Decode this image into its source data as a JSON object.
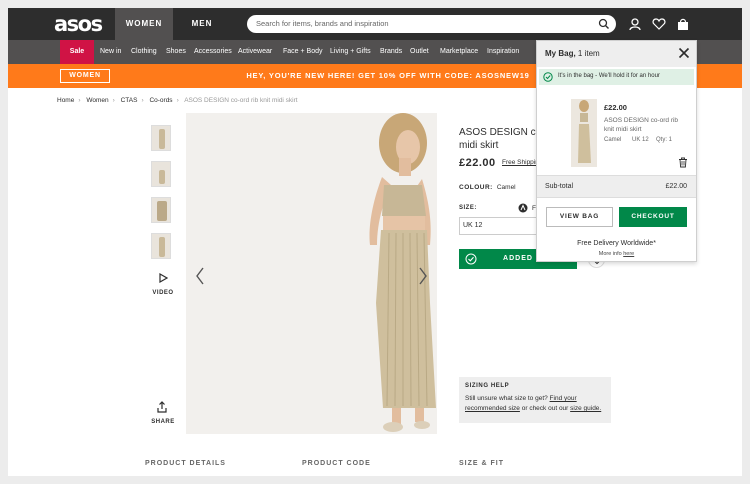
{
  "header": {
    "logo": "asos",
    "tabs": [
      {
        "label": "WOMEN"
      },
      {
        "label": "MEN"
      }
    ],
    "search_placeholder": "Search for items, brands and inspiration",
    "icons": [
      "account-icon",
      "heart-icon",
      "bag-icon"
    ]
  },
  "nav": {
    "sale": "Sale",
    "items": [
      "New in",
      "Clothing",
      "Shoes",
      "Accessories",
      "Activewear",
      "Face + Body",
      "Living + Gifts",
      "Brands",
      "Outlet",
      "Marketplace",
      "Inspiration"
    ]
  },
  "promo": {
    "button": "WOMEN",
    "text": "HEY, YOU'RE NEW HERE! GET 10% OFF WITH CODE: ASOSNEW19"
  },
  "breadcrumb": [
    "Home",
    "Women",
    "CTAS",
    "Co-ords",
    "ASOS DESIGN co-ord rib knit midi skirt"
  ],
  "gallery": {
    "video_label": "VIDEO",
    "share_label": "SHARE"
  },
  "product": {
    "name": "ASOS DESIGN co-ord rib knit midi skirt",
    "name_visible": "ASOS DESIGN co",
    "name_line2": "midi skirt",
    "price": "£22.00",
    "shipping": "Free Shipping",
    "colour_label": "COLOUR:",
    "colour_value": "Camel",
    "size_label": "SIZE:",
    "fit_label": "Fi",
    "size_value": "UK 12",
    "added_label": "ADDED"
  },
  "sizing_help": {
    "title": "SIZING HELP",
    "line1_prefix": "Still unsure what size to get? ",
    "link1": "Find your",
    "link2": "recommended size",
    "line2_mid": " or check out our ",
    "link3": "size guide."
  },
  "bottom_headings": [
    "PRODUCT DETAILS",
    "PRODUCT CODE",
    "SIZE & FIT"
  ],
  "minibag": {
    "title": "My Bag,",
    "count": "1 item",
    "notice": "It's in the bag - We'll hold it for an hour",
    "item": {
      "price": "£22.00",
      "name": "ASOS DESIGN co-ord rib knit midi skirt",
      "colour": "Camel",
      "size": "UK 12",
      "qty": "Qty: 1"
    },
    "subtotal_label": "Sub-total",
    "subtotal_value": "£22.00",
    "view_bag": "VIEW BAG",
    "checkout": "CHECKOUT",
    "free_delivery": "Free Delivery Worldwide*",
    "more_info_prefix": "More info ",
    "more_info_link": "here"
  },
  "colors": {
    "header_bg": "#2d2d2d",
    "nav_bg": "#525050",
    "sale_red": "#d01345",
    "promo_orange": "#ff7a1a",
    "green": "#018849"
  }
}
